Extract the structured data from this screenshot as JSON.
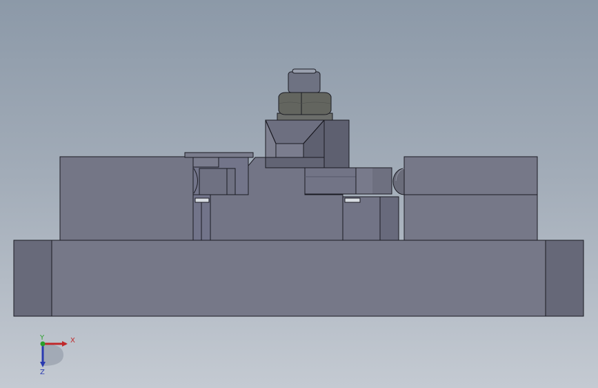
{
  "viewport": {
    "description_visible_text": "none"
  },
  "colors": {
    "background_top": "#8c99a8",
    "background_bottom": "#c4cad2",
    "body_face": "#757787",
    "body_face_dark": "#686a7a",
    "body_side": "#5f6170",
    "outline": "#1a1a22",
    "nut": "#63655f",
    "nut_dark": "#525450",
    "stud": "#6e7282",
    "x_axis": "#c0282a",
    "y_axis": "#2aa02a",
    "z_axis": "#2a3ab0"
  },
  "triad": {
    "x_label": "X",
    "y_label": "Y",
    "z_label": "Z"
  }
}
